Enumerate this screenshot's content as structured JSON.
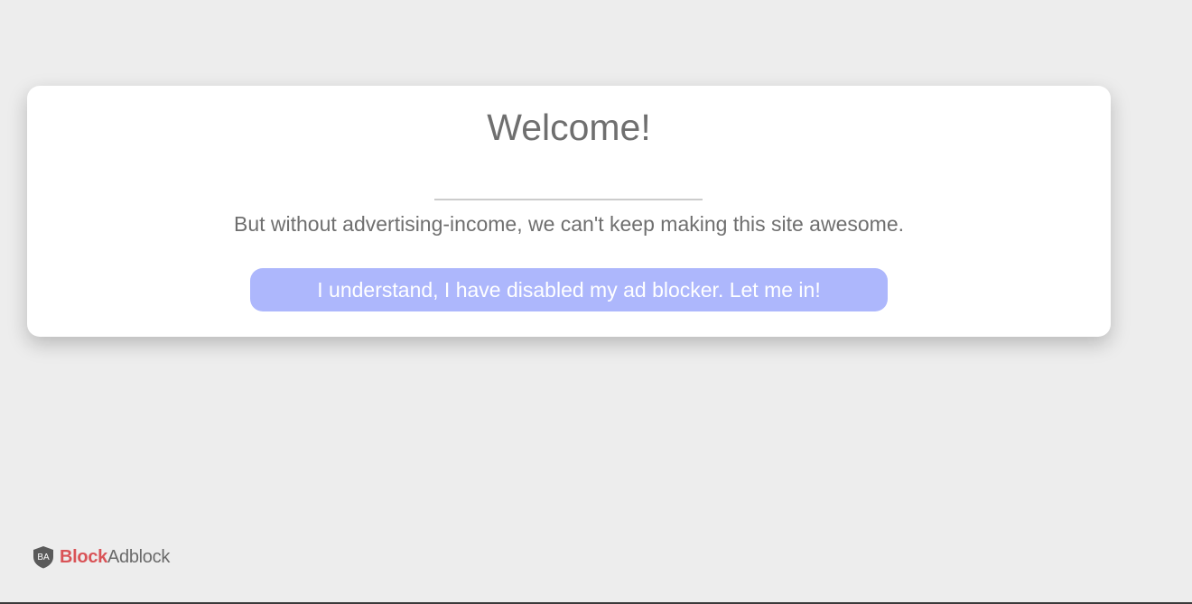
{
  "modal": {
    "title": "Welcome!",
    "message": "But without advertising-income, we can't keep making this site awesome.",
    "confirm_label": "I understand, I have disabled my ad blocker. Let me in!"
  },
  "brand": {
    "shield_initials": "BA",
    "block_text": "Block",
    "adblock_text": "Adblock",
    "icon": "shield-icon"
  },
  "colors": {
    "background": "#ededed",
    "text": "#6f6f6f",
    "button": "#adb7fc",
    "brand_red": "#d95357"
  }
}
